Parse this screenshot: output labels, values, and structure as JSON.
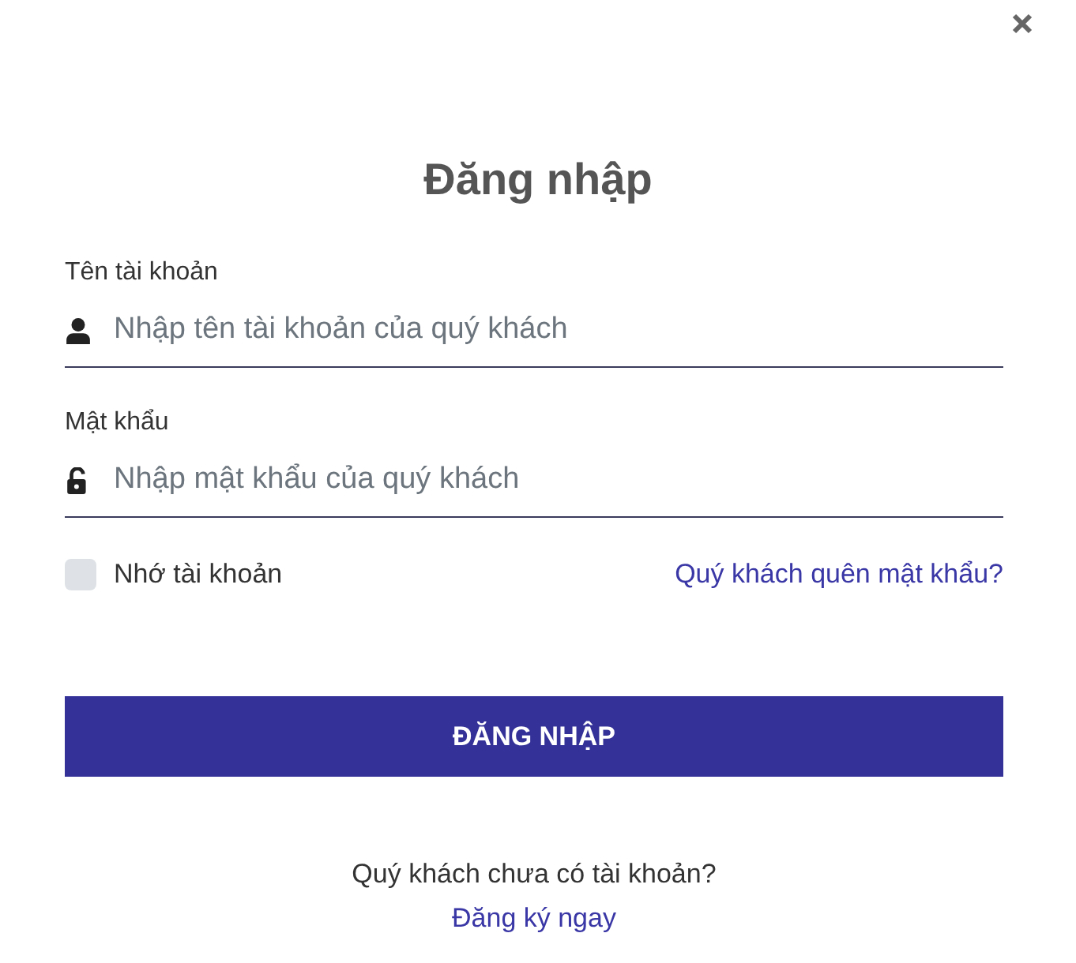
{
  "title": "Đăng nhập",
  "fields": [
    {
      "kind": "user",
      "label": "Tên tài khoản",
      "placeholder": "Nhập tên tài khoản của quý khách"
    },
    {
      "kind": "password",
      "label": "Mật khẩu",
      "placeholder": "Nhập mật khẩu của quý khách"
    }
  ],
  "remember": {
    "label": "Nhớ tài khoản",
    "checked": false
  },
  "forgot_link": "Quý khách quên mật khẩu?",
  "submit_button": "ĐĂNG NHẬP",
  "signup": {
    "prompt": "Quý khách chưa có tài khoản?",
    "link": "Đăng ký ngay"
  }
}
